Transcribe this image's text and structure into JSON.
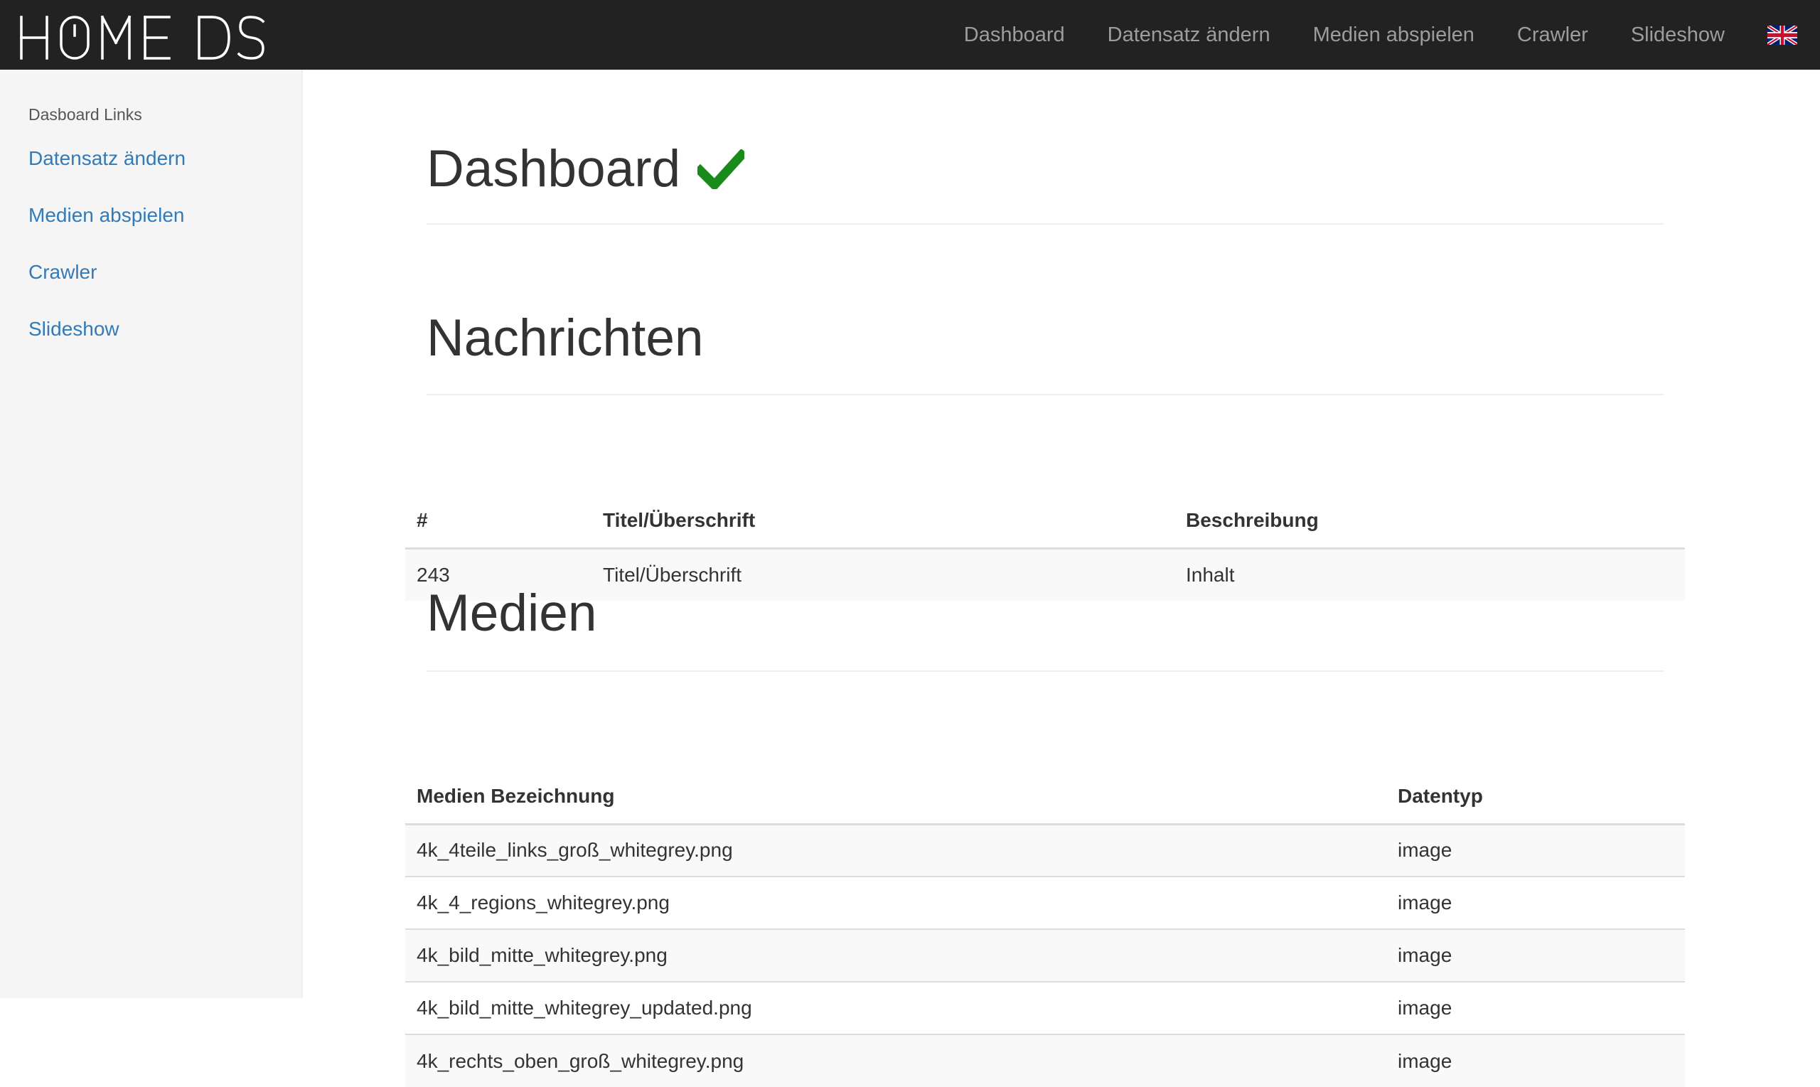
{
  "brand": {
    "name": "HOME DS"
  },
  "navbar": {
    "items": [
      {
        "label": "Dashboard"
      },
      {
        "label": "Datensatz ändern"
      },
      {
        "label": "Medien abspielen"
      },
      {
        "label": "Crawler"
      },
      {
        "label": "Slideshow"
      }
    ],
    "language_icon": "uk-flag-icon"
  },
  "sidebar": {
    "heading": "Dasboard Links",
    "items": [
      {
        "label": "Datensatz ändern"
      },
      {
        "label": "Medien abspielen"
      },
      {
        "label": "Crawler"
      },
      {
        "label": "Slideshow"
      }
    ]
  },
  "main": {
    "title": "Dashboard",
    "title_icon": "checkmark-icon",
    "status_color": "#1a8a1a",
    "nachrichten": {
      "heading": "Nachrichten",
      "columns": [
        "#",
        "Titel/Überschrift",
        "Beschreibung"
      ],
      "rows": [
        [
          "243",
          "Titel/Überschrift",
          "Inhalt"
        ]
      ]
    },
    "medien": {
      "heading": "Medien",
      "columns": [
        "Medien Bezeichnung",
        "Datentyp"
      ],
      "rows": [
        [
          "4k_4teile_links_groß_whitegrey.png",
          "image"
        ],
        [
          "4k_4_regions_whitegrey.png",
          "image"
        ],
        [
          "4k_bild_mitte_whitegrey.png",
          "image"
        ],
        [
          "4k_bild_mitte_whitegrey_updated.png",
          "image"
        ],
        [
          "4k_rechts_oben_groß_whitegrey.png",
          "image"
        ]
      ]
    }
  },
  "colors": {
    "navbar_bg": "#222222",
    "nav_text": "#9d9d9d",
    "link": "#337ab7",
    "sidebar_bg": "#f5f5f5"
  }
}
